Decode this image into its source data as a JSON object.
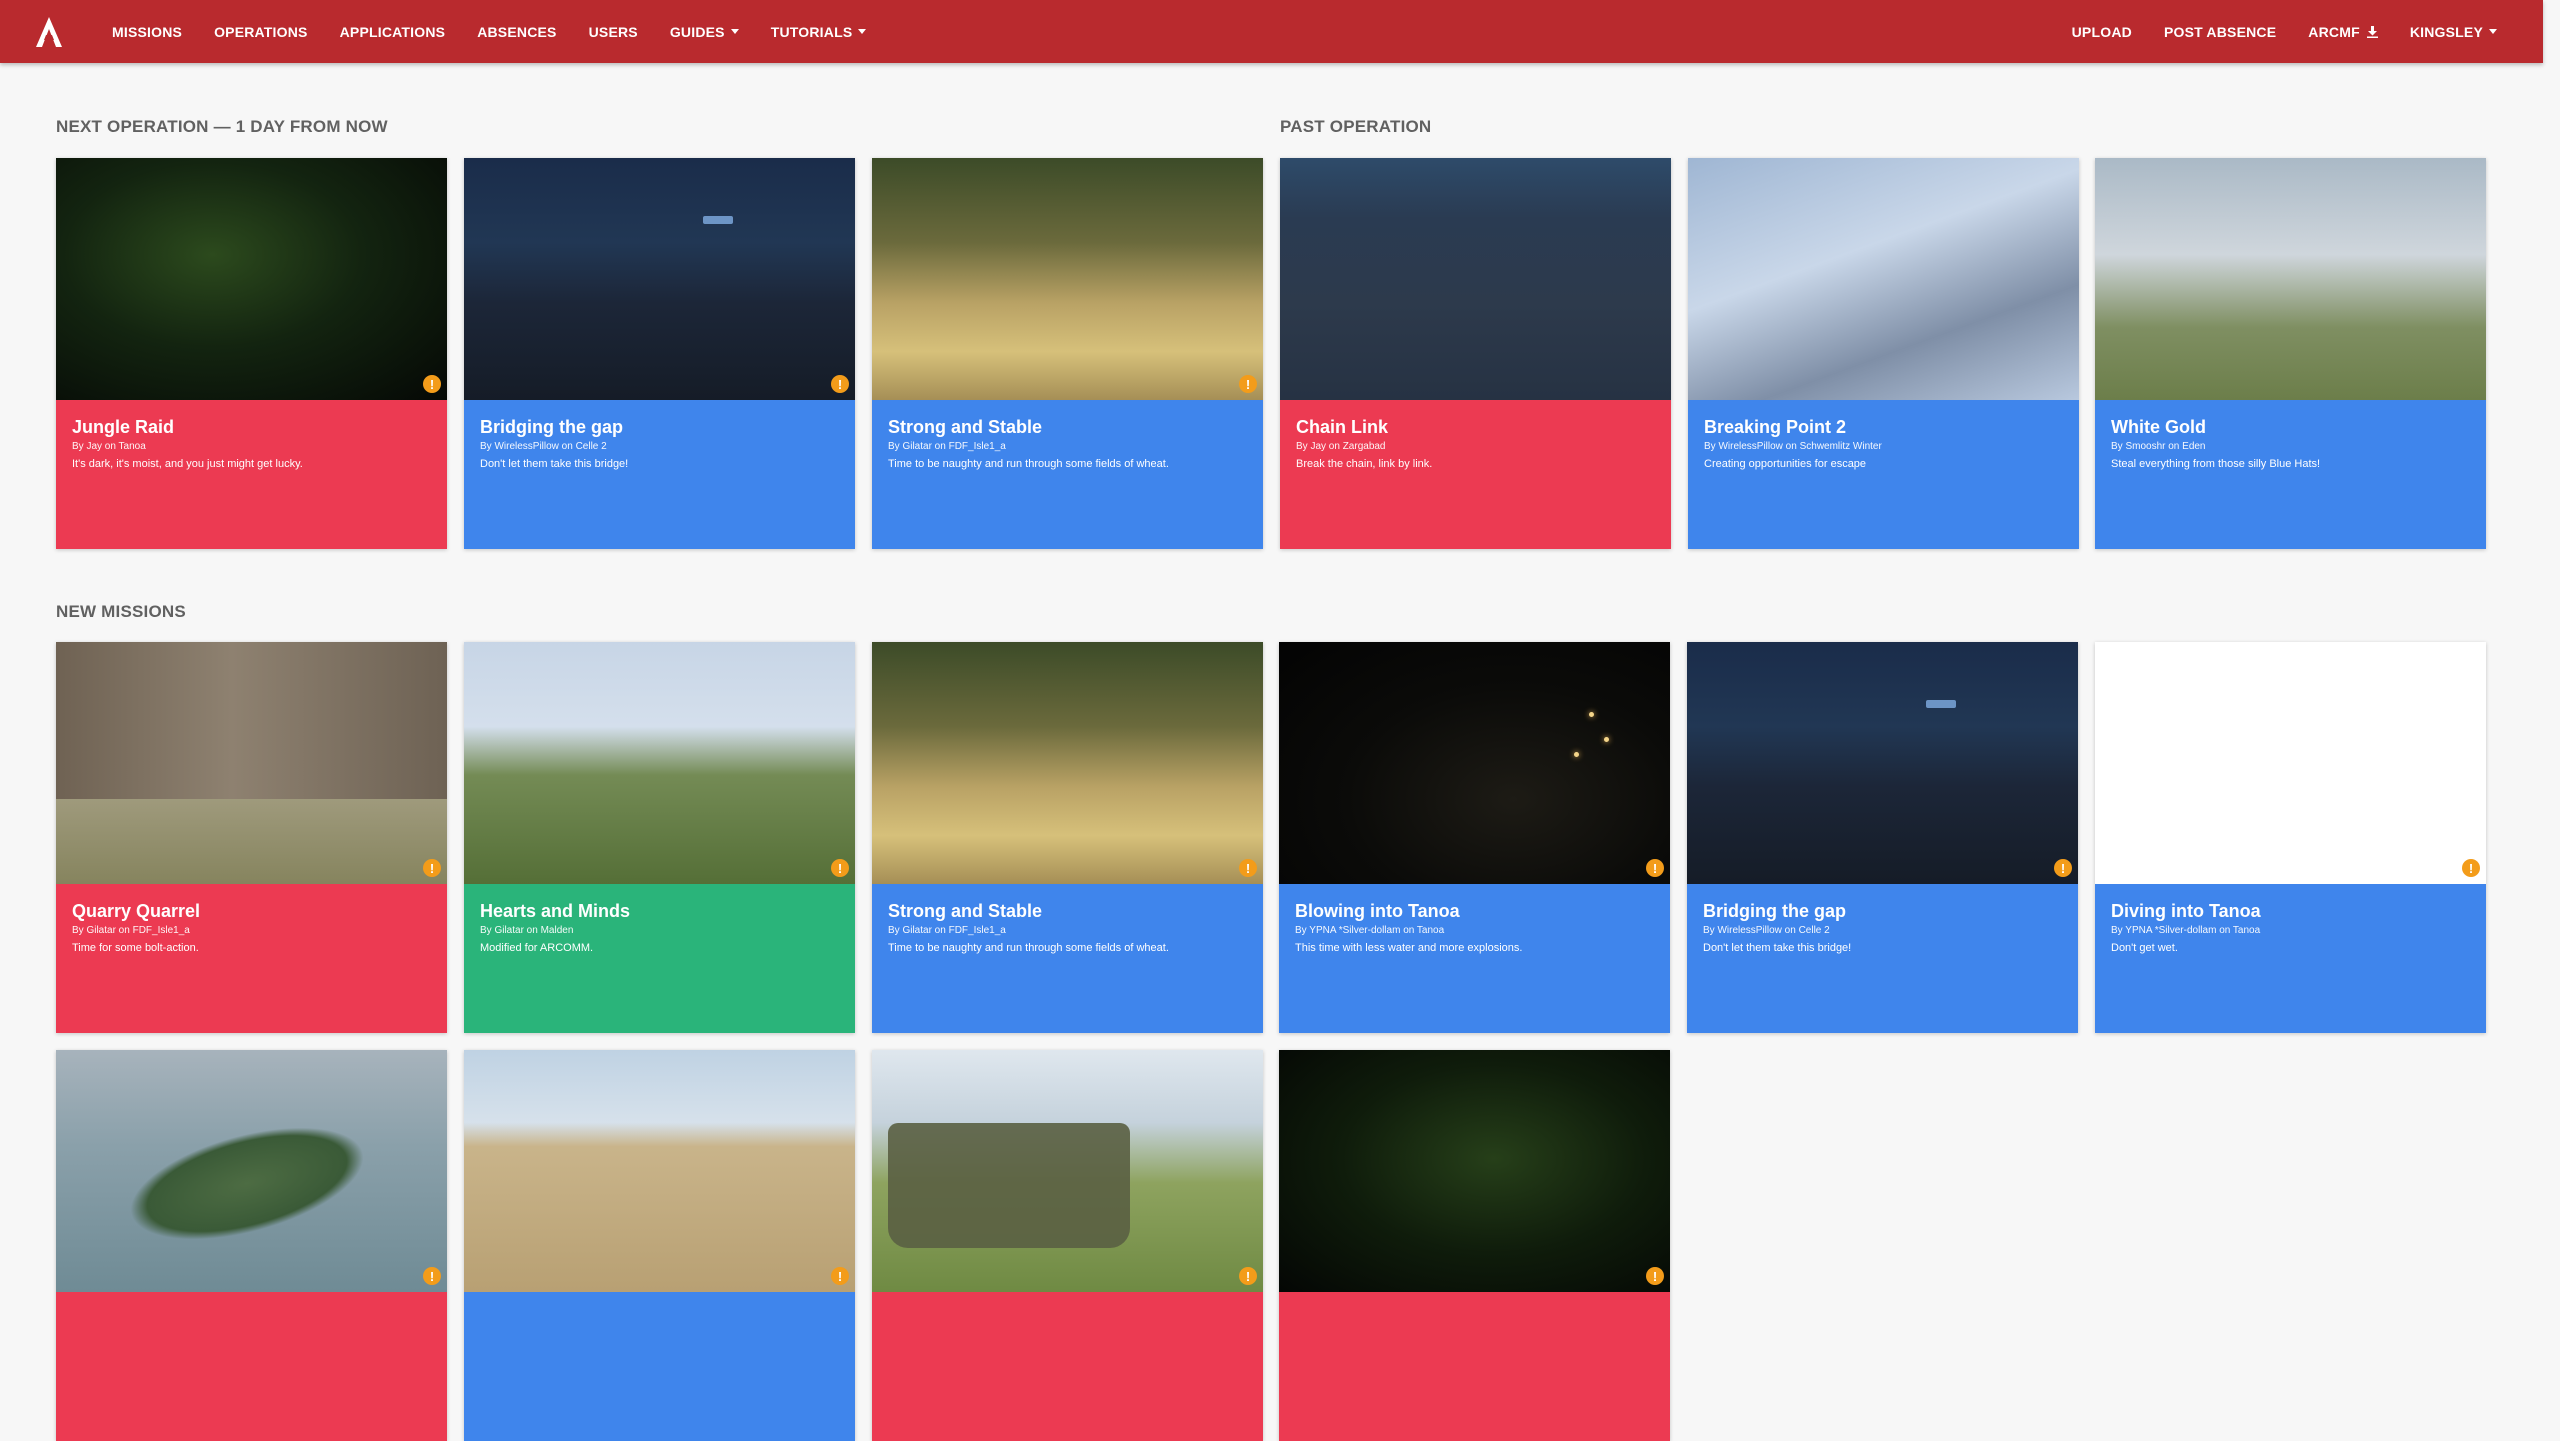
{
  "navbar": {
    "left_items": [
      {
        "label": "MISSIONS",
        "dropdown": false
      },
      {
        "label": "OPERATIONS",
        "dropdown": false
      },
      {
        "label": "APPLICATIONS",
        "dropdown": false
      },
      {
        "label": "ABSENCES",
        "dropdown": false
      },
      {
        "label": "USERS",
        "dropdown": false
      },
      {
        "label": "GUIDES",
        "dropdown": true
      },
      {
        "label": "TUTORIALS",
        "dropdown": true
      }
    ],
    "right_items": {
      "upload": "UPLOAD",
      "post_absence": "POST ABSENCE",
      "arcmf": "ARCMF",
      "user": "KINGSLEY"
    },
    "brand_color": "#b92a2e"
  },
  "next_operation": {
    "heading": "NEXT OPERATION — 1 DAY FROM NOW",
    "cards": [
      {
        "title": "Jungle Raid",
        "meta": "By Jay on Tanoa",
        "desc": "It's dark, it's moist, and you just might get lucky.",
        "color": "red",
        "warning": true,
        "thumb": "jungle"
      },
      {
        "title": "Bridging the gap",
        "meta": "By WirelessPillow on Celle 2",
        "desc": "Don't let them take this bridge!",
        "color": "blue",
        "warning": true,
        "thumb": "road"
      },
      {
        "title": "Strong and Stable",
        "meta": "By Gilatar on FDF_Isle1_a",
        "desc": "Time to be naughty and run through some fields of wheat.",
        "color": "blue",
        "warning": true,
        "thumb": "wheat"
      }
    ]
  },
  "past_operation": {
    "heading": "PAST OPERATION",
    "cards": [
      {
        "title": "Chain Link",
        "meta": "By Jay on Zargabad",
        "desc": "Break the chain, link by link.",
        "color": "red",
        "warning": false,
        "thumb": "chain"
      },
      {
        "title": "Breaking Point 2",
        "meta": "By WirelessPillow on Schwemlitz Winter",
        "desc": "Creating opportunities for escape",
        "color": "blue",
        "warning": false,
        "thumb": "snow"
      },
      {
        "title": "White Gold",
        "meta": "By Smooshr on Eden",
        "desc": "Steal everything from those silly Blue Hats!",
        "color": "blue",
        "warning": false,
        "thumb": "un"
      }
    ]
  },
  "new_missions": {
    "heading": "NEW MISSIONS",
    "cards": [
      {
        "title": "Quarry Quarrel",
        "meta": "By Gilatar on FDF_Isle1_a",
        "desc": "Time for some bolt-action.",
        "color": "red",
        "warning": true,
        "thumb": "quarry"
      },
      {
        "title": "Hearts and Minds",
        "meta": "By Gilatar on Malden",
        "desc": "Modified for ARCOMM.",
        "color": "green",
        "warning": true,
        "thumb": "hearts"
      },
      {
        "title": "Strong and Stable",
        "meta": "By Gilatar on FDF_Isle1_a",
        "desc": "Time to be naughty and run through some fields of wheat.",
        "color": "blue",
        "warning": true,
        "thumb": "wheat"
      },
      {
        "title": "Blowing into Tanoa",
        "meta": "By YPNA *Silver-dollam on Tanoa",
        "desc": "This time with less water and more explosions.",
        "color": "blue",
        "warning": true,
        "thumb": "blowing"
      },
      {
        "title": "Bridging the gap",
        "meta": "By WirelessPillow on Celle 2",
        "desc": "Don't let them take this bridge!",
        "color": "blue",
        "warning": true,
        "thumb": "road"
      },
      {
        "title": "Diving into Tanoa",
        "meta": "By YPNA *Silver-dollam on Tanoa",
        "desc": "Don't get wet.",
        "color": "blue",
        "warning": true,
        "thumb": "white"
      },
      {
        "title": "",
        "meta": "",
        "desc": "",
        "color": "red",
        "warning": true,
        "thumb": "island"
      },
      {
        "title": "",
        "meta": "",
        "desc": "",
        "color": "blue",
        "warning": true,
        "thumb": "desert"
      },
      {
        "title": "",
        "meta": "",
        "desc": "",
        "color": "red",
        "warning": true,
        "thumb": "tank"
      },
      {
        "title": "",
        "meta": "",
        "desc": "",
        "color": "red",
        "warning": true,
        "thumb": "jungle2"
      }
    ]
  },
  "colors": {
    "red": "#ec3a52",
    "blue": "#3f85ec",
    "green": "#2ab47a",
    "warning": "#f39c1a"
  }
}
